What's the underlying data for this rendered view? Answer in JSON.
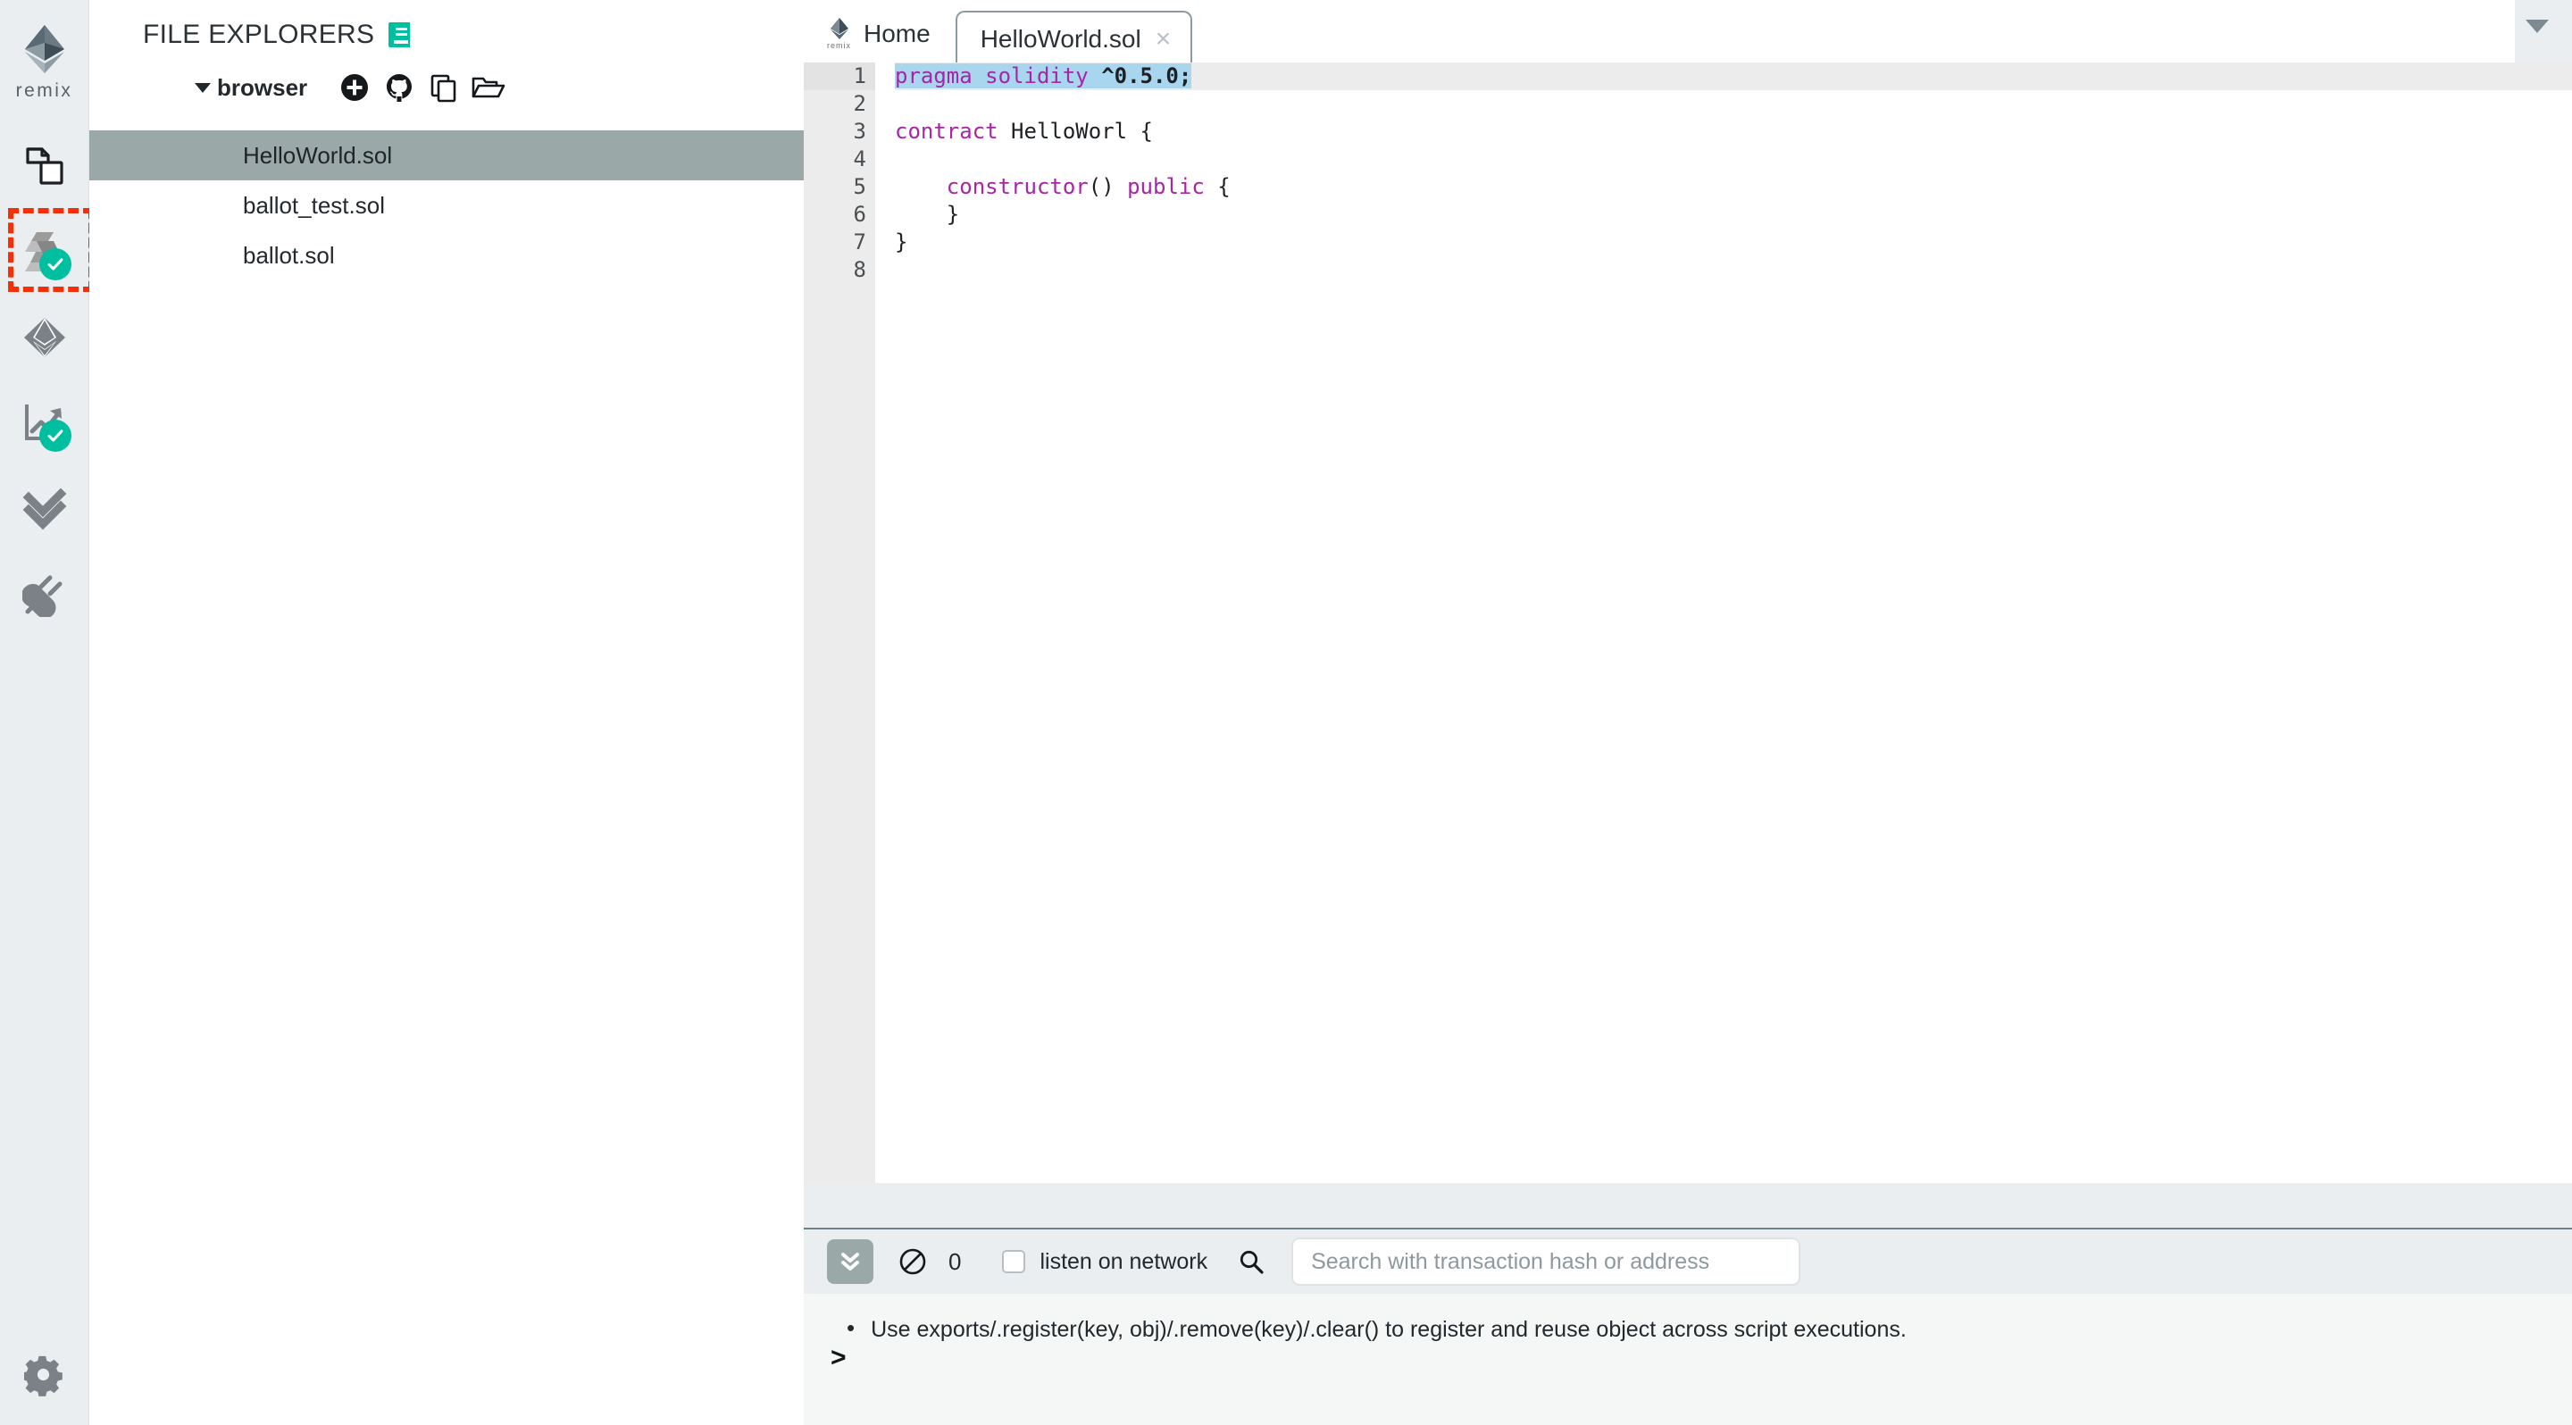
{
  "iconbar": {
    "brand_label": "remix",
    "items": [
      {
        "name": "file-explorers",
        "icon": "files-icon",
        "badge": null
      },
      {
        "name": "solidity-compiler",
        "icon": "solidity-icon",
        "badge": "check",
        "highlighted": true
      },
      {
        "name": "deploy-run-transactions",
        "icon": "ethereum-deploy-icon",
        "badge": null
      },
      {
        "name": "analysis",
        "icon": "chart-analysis-icon",
        "badge": "check"
      },
      {
        "name": "testing",
        "icon": "double-check-icon",
        "badge": null
      },
      {
        "name": "plugin-manager",
        "icon": "plug-icon",
        "badge": null
      }
    ],
    "settings": {
      "name": "settings",
      "icon": "gear-icon"
    }
  },
  "explorer": {
    "title": "FILE EXPLORERS",
    "badge_icon": "book-icon",
    "folder_name": "browser",
    "toolbar": [
      {
        "name": "create-new-file",
        "icon": "plus-circle-icon"
      },
      {
        "name": "connect-to-github",
        "icon": "github-icon"
      },
      {
        "name": "copy-files",
        "icon": "copy-icon"
      },
      {
        "name": "open-folder",
        "icon": "folder-open-icon"
      }
    ],
    "files": [
      {
        "name": "HelloWorld.sol",
        "selected": true
      },
      {
        "name": "ballot_test.sol",
        "selected": false
      },
      {
        "name": "ballot.sol",
        "selected": false
      }
    ]
  },
  "tabs": {
    "home": {
      "label": "Home",
      "logo_label": "remix"
    },
    "files": [
      {
        "label": "HelloWorld.sol",
        "active": true,
        "close_glyph": "×"
      }
    ],
    "overflow_icon": "chevron-down-icon"
  },
  "editor": {
    "active_line": 1,
    "lines": [
      {
        "n": "1",
        "fold": false,
        "active": true,
        "selected": true,
        "tokens": [
          {
            "t": "pragma solidity ",
            "c": "kw"
          },
          {
            "t": "^0.5.0;",
            "c": "num"
          }
        ]
      },
      {
        "n": "2",
        "fold": false,
        "active": false,
        "selected": false,
        "tokens": []
      },
      {
        "n": "3",
        "fold": true,
        "active": false,
        "selected": false,
        "tokens": [
          {
            "t": "contract ",
            "c": "kw"
          },
          {
            "t": "HelloWorl {",
            "c": "plain"
          }
        ]
      },
      {
        "n": "4",
        "fold": false,
        "active": false,
        "selected": false,
        "tokens": []
      },
      {
        "n": "5",
        "fold": true,
        "active": false,
        "selected": false,
        "tokens": [
          {
            "t": "    constructor",
            "c": "kw"
          },
          {
            "t": "() ",
            "c": "plain"
          },
          {
            "t": "public",
            "c": "kw"
          },
          {
            "t": " {",
            "c": "plain"
          }
        ]
      },
      {
        "n": "6",
        "fold": false,
        "active": false,
        "selected": false,
        "tokens": [
          {
            "t": "    }",
            "c": "plain"
          }
        ]
      },
      {
        "n": "7",
        "fold": false,
        "active": false,
        "selected": false,
        "tokens": [
          {
            "t": "}",
            "c": "plain"
          }
        ]
      },
      {
        "n": "8",
        "fold": false,
        "active": false,
        "selected": false,
        "tokens": []
      }
    ]
  },
  "terminal": {
    "expand_icon": "double-chevron-down-icon",
    "clear_icon": "ban-icon",
    "pending_count": "0",
    "listen_label": "listen on network",
    "listen_checked": false,
    "search_icon": "search-icon",
    "search_placeholder": "Search with transaction hash or address",
    "search_value": "",
    "log_lines": [
      "Use exports/.register(key, obj)/.remove(key)/.clear() to register and reuse object across script executions."
    ],
    "prompt": ">"
  },
  "colors": {
    "accent_teal": "#00bfa0",
    "annotation_red": "#f62f06",
    "selection_blue": "#a8d6ef",
    "keyword_purple": "#a626a4",
    "file_selected": "#9aa8a8",
    "panel_bg": "#eaeef0"
  }
}
